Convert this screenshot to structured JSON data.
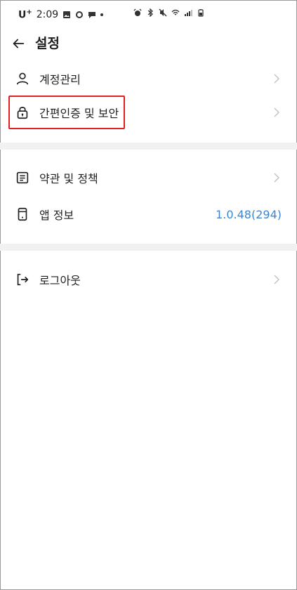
{
  "status_bar": {
    "carrier": "U",
    "carrier_sup": "+",
    "time": "2:09"
  },
  "header": {
    "title": "설정"
  },
  "menu": {
    "account": {
      "label": "계정관리",
      "icon": "user-icon"
    },
    "security": {
      "label": "간편인증 및 보안",
      "icon": "lock-icon"
    },
    "terms": {
      "label": "약관 및 정책",
      "icon": "document-icon"
    },
    "app_info": {
      "label": "앱 정보",
      "icon": "phone-icon",
      "value": "1.0.48(294)"
    },
    "logout": {
      "label": "로그아웃",
      "icon": "logout-icon"
    }
  },
  "colors": {
    "accent_value": "#3a86d2",
    "highlight_border": "#e02020",
    "divider": "#f1f1f1"
  }
}
